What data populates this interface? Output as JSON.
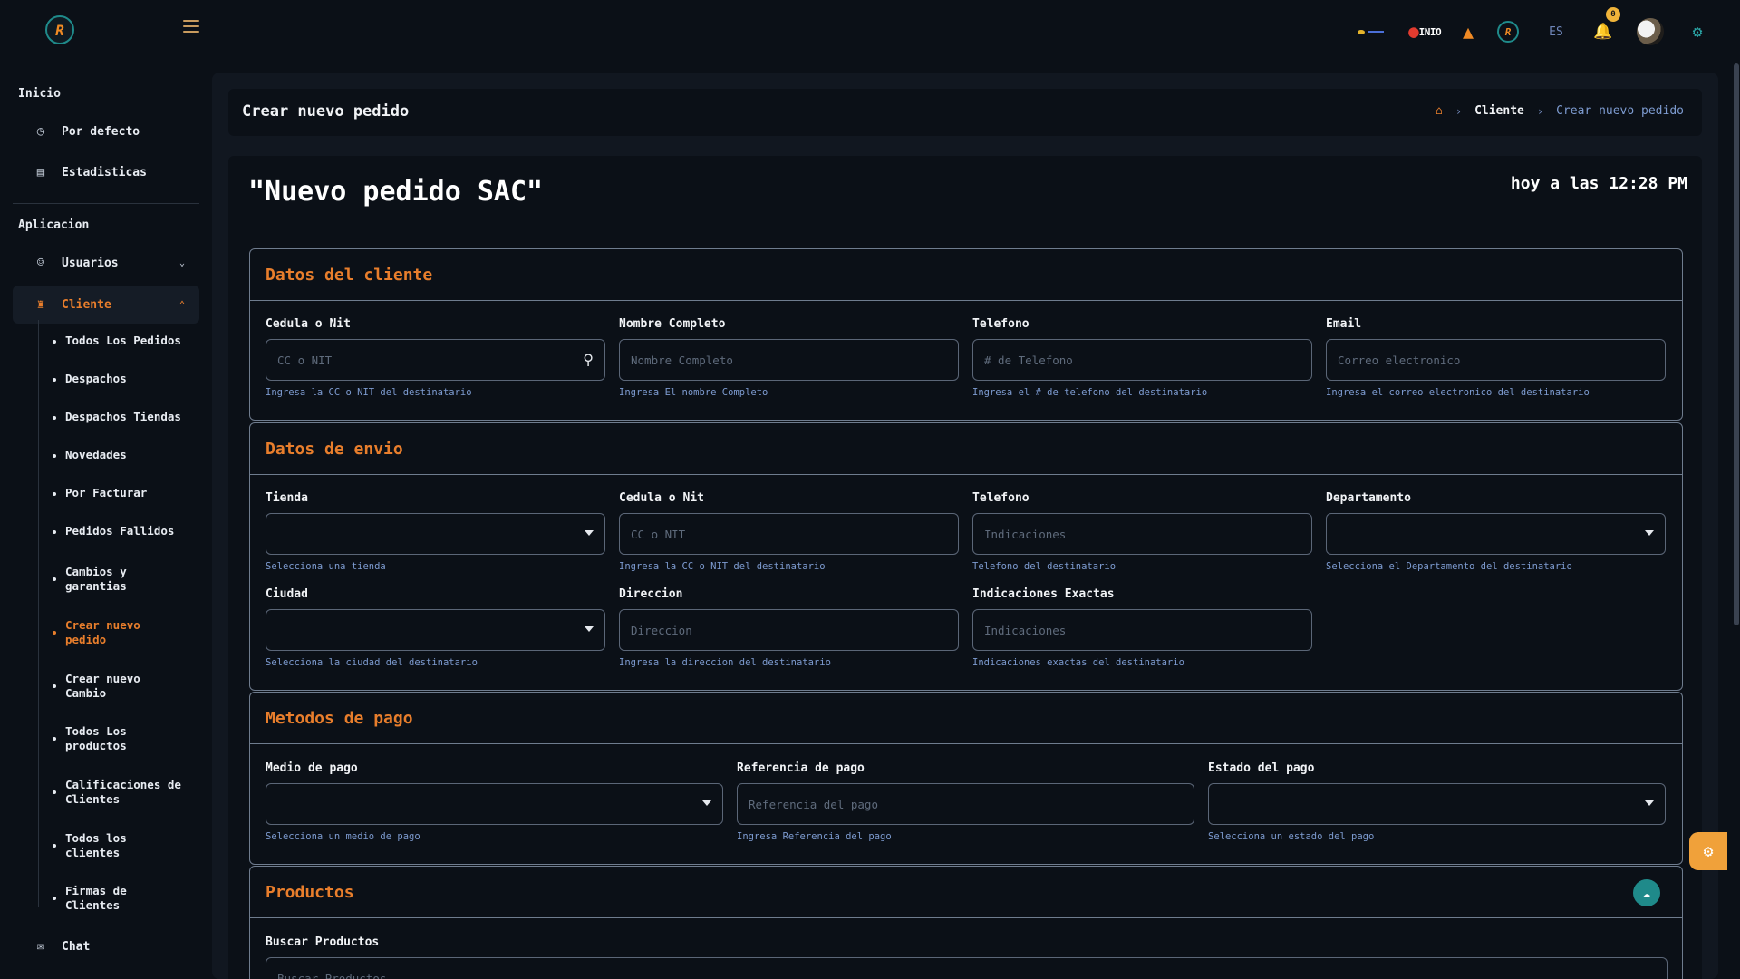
{
  "topbar": {
    "brand_b_prefix": "⬤",
    "brand_b_text": "INIO",
    "lang": "ES",
    "notifications_count": "0"
  },
  "sidebar": {
    "section_inicio": "Inicio",
    "por_defecto": "Por defecto",
    "estadisticas": "Estadisticas",
    "section_aplicacion": "Aplicacion",
    "usuarios": "Usuarios",
    "cliente": "Cliente",
    "submenu": [
      "Todos Los Pedidos",
      "Despachos",
      "Despachos Tiendas",
      "Novedades",
      "Por Facturar",
      "Pedidos Fallidos",
      "Cambios y garantias",
      "Crear nuevo pedido",
      "Crear nuevo Cambio",
      "Todos Los productos",
      "Calificaciones de Clientes",
      "Todos los clientes",
      "Firmas de Clientes"
    ],
    "chat": "Chat"
  },
  "header": {
    "page_title": "Crear nuevo pedido",
    "breadcrumb_1": "Cliente",
    "breadcrumb_2": "Crear nuevo pedido"
  },
  "order": {
    "title": "\"Nuevo pedido SAC\"",
    "time": "hoy a las 12:28 PM"
  },
  "cliente": {
    "heading": "Datos del cliente",
    "cedula_label": "Cedula o Nit",
    "cedula_placeholder": "CC o NIT",
    "cedula_help": "Ingresa la CC o NIT del destinatario",
    "nombre_label": "Nombre Completo",
    "nombre_placeholder": "Nombre Completo",
    "nombre_help": "Ingresa El nombre Completo",
    "telefono_label": "Telefono",
    "telefono_placeholder": "# de Telefono",
    "telefono_help": "Ingresa el # de telefono del destinatario",
    "email_label": "Email",
    "email_placeholder": "Correo electronico",
    "email_help": "Ingresa el correo electronico del destinatario"
  },
  "envio": {
    "heading": "Datos de envio",
    "tienda_label": "Tienda",
    "tienda_help": "Selecciona una tienda",
    "cedula_label": "Cedula o Nit",
    "cedula_placeholder": "CC o NIT",
    "cedula_help": "Ingresa la CC o NIT del destinatario",
    "telefono_label": "Telefono",
    "telefono_placeholder": "Indicaciones",
    "telefono_help": "Telefono del destinatario",
    "depto_label": "Departamento",
    "depto_help": "Selecciona el Departamento del destinatario",
    "ciudad_label": "Ciudad",
    "ciudad_help": "Selecciona la ciudad del destinatario",
    "direccion_label": "Direccion",
    "direccion_placeholder": "Direccion",
    "direccion_help": "Ingresa la direccion del destinatario",
    "indicaciones_label": "Indicaciones Exactas",
    "indicaciones_placeholder": "Indicaciones",
    "indicaciones_help": "Indicaciones exactas del destinatario"
  },
  "pago": {
    "heading": "Metodos de pago",
    "medio_label": "Medio de pago",
    "medio_help": "Selecciona un medio de pago",
    "referencia_label": "Referencia de pago",
    "referencia_placeholder": "Referencia del pago",
    "referencia_help": "Ingresa Referencia del pago",
    "estado_label": "Estado del pago",
    "estado_help": "Selecciona un estado del pago"
  },
  "productos": {
    "heading": "Productos",
    "buscar_label": "Buscar Productos",
    "buscar_placeholder": "Buscar Productos"
  },
  "colors": {
    "accent": "#e87e2c",
    "teal": "#1f8a8a",
    "help_text": "#7d9bd0",
    "background": "#0b1017"
  }
}
